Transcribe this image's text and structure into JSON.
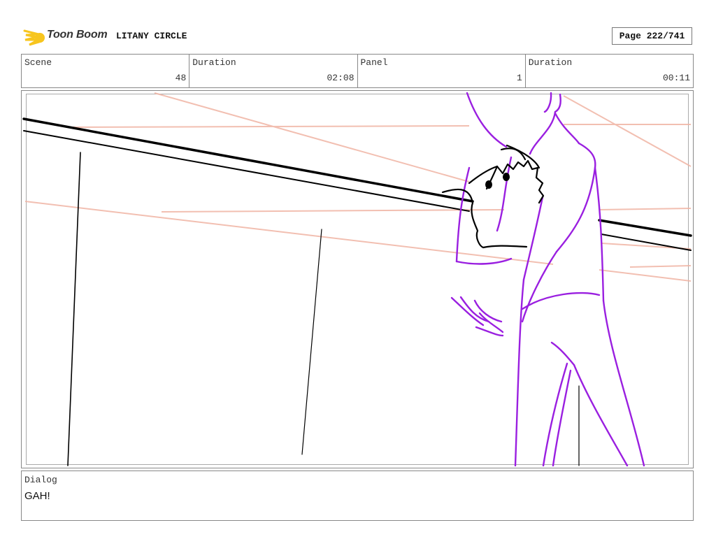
{
  "header": {
    "logo_text": "Toon Boom",
    "project_title": "LITANY CIRCLE",
    "page_label": "Page 222/741"
  },
  "info": {
    "scene_label": "Scene",
    "scene_value": "48",
    "scene_duration_label": "Duration",
    "scene_duration_value": "02:08",
    "panel_label": "Panel",
    "panel_value": "1",
    "panel_duration_label": "Duration",
    "panel_duration_value": "00:11"
  },
  "dialog": {
    "label": "Dialog",
    "text": "GAH!"
  },
  "colors": {
    "character_stroke": "#9a1fe0",
    "guide_stroke": "#f0b4a4",
    "ink_stroke": "#000000",
    "logo_accent": "#f7c51e"
  }
}
